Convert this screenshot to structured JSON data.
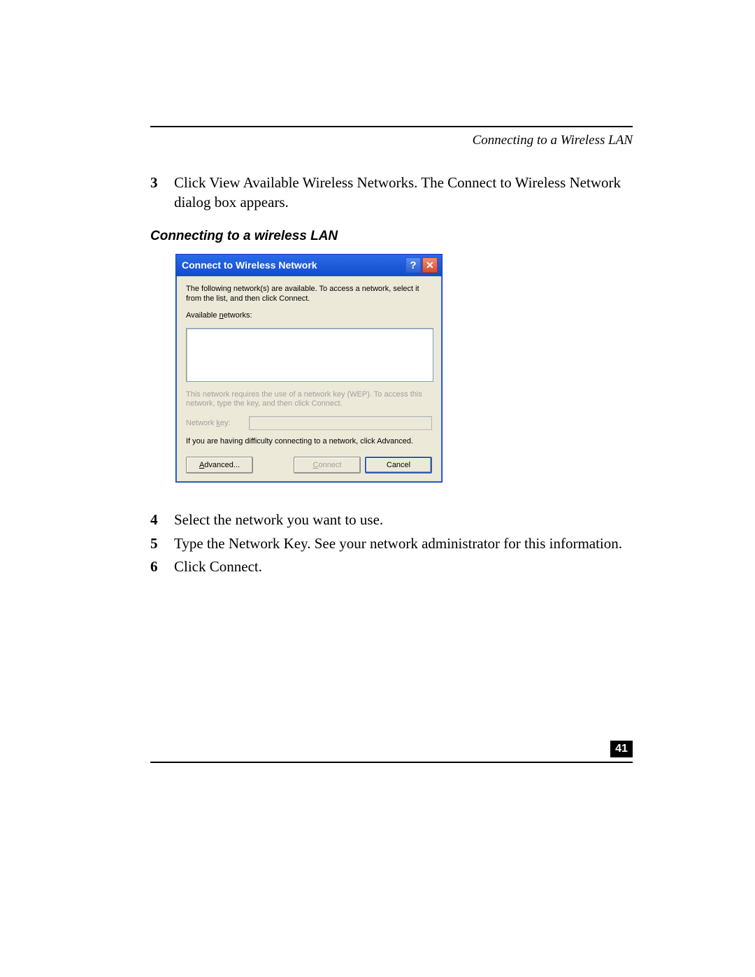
{
  "header": {
    "running_head": "Connecting to a Wireless LAN"
  },
  "steps_top": [
    {
      "num": "3",
      "text": "Click View Available Wireless Networks. The Connect to Wireless Network dialog box appears."
    }
  ],
  "figure_caption": "Connecting to a wireless LAN",
  "dialog": {
    "title": "Connect to Wireless Network",
    "help_glyph": "?",
    "close_glyph": "✕",
    "intro": "The following network(s) are available. To access a network, select it from the list, and then click Connect.",
    "available_label_pre": "Available ",
    "available_label_u": "n",
    "available_label_post": "etworks:",
    "wep_text": "This network requires the use of a network key (WEP). To access this network, type the key, and then click Connect.",
    "key_label_pre": "Network ",
    "key_label_u": "k",
    "key_label_post": "ey:",
    "difficulty": "If you are having difficulty connecting to a network, click Advanced.",
    "btn_advanced_u": "A",
    "btn_advanced_post": "dvanced...",
    "btn_connect_u": "C",
    "btn_connect_post": "onnect",
    "btn_cancel": "Cancel"
  },
  "steps_bottom": [
    {
      "num": "4",
      "text": "Select the network you want to use."
    },
    {
      "num": "5",
      "text": "Type the Network Key. See your network administrator for this information."
    },
    {
      "num": "6",
      "text": "Click Connect."
    }
  ],
  "page_number": "41"
}
